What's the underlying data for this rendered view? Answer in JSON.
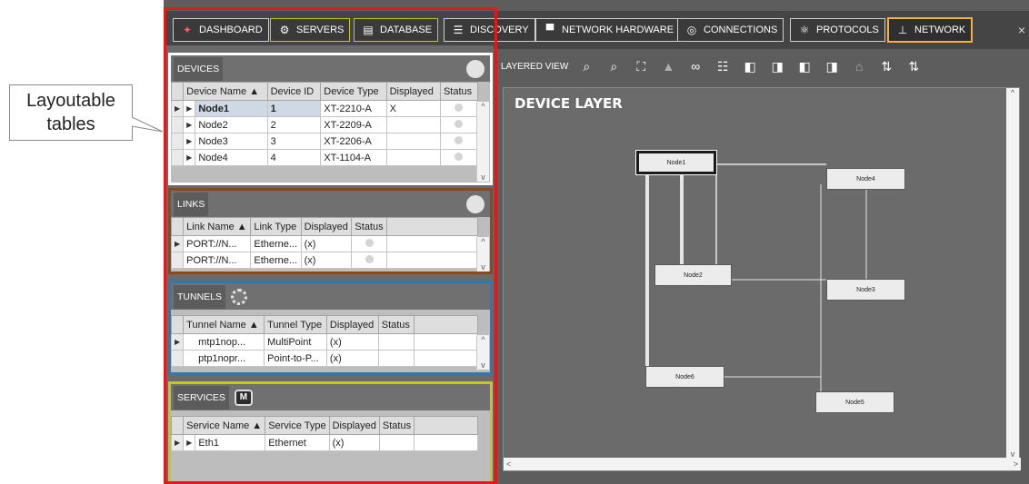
{
  "callout": {
    "text": "Layoutable\ntables"
  },
  "tabs": [
    {
      "label": "DASHBOARD",
      "icon": "dashboard-icon",
      "glyph": "✦"
    },
    {
      "label": "SERVERS",
      "icon": "gear-icon",
      "glyph": "⚙"
    },
    {
      "label": "DATABASE",
      "icon": "database-icon",
      "glyph": "▤"
    },
    {
      "label": "DISCOVERY",
      "icon": "list-icon",
      "glyph": "☰"
    },
    {
      "label": "NETWORK HARDWARE",
      "icon": "hardware-icon",
      "glyph": "▀"
    },
    {
      "label": "CONNECTIONS",
      "icon": "connections-icon",
      "glyph": "◎"
    },
    {
      "label": "PROTOCOLS",
      "icon": "protocols-icon",
      "glyph": "⚛"
    },
    {
      "label": "NETWORK",
      "icon": "network-icon",
      "glyph": "⊥"
    }
  ],
  "close_glyph": "×",
  "devices": {
    "title": "DEVICES",
    "columns": [
      "Device Name ▲",
      "Device ID",
      "Device Type",
      "Displayed",
      "Status"
    ],
    "rows": [
      {
        "name": "Node1",
        "id": "1",
        "type": "XT-2210-A",
        "displayed": "X"
      },
      {
        "name": "Node2",
        "id": "2",
        "type": "XT-2209-A",
        "displayed": ""
      },
      {
        "name": "Node3",
        "id": "3",
        "type": "XT-2206-A",
        "displayed": ""
      },
      {
        "name": "Node4",
        "id": "4",
        "type": "XT-1104-A",
        "displayed": ""
      }
    ]
  },
  "links": {
    "title": "LINKS",
    "columns": [
      "Link Name ▲",
      "Link Type",
      "Displayed",
      "Status"
    ],
    "rows": [
      {
        "name": "PORT://N...",
        "type": "Etherne...",
        "displayed": "(x)"
      },
      {
        "name": "PORT://N...",
        "type": "Etherne...",
        "displayed": "(x)"
      }
    ]
  },
  "tunnels": {
    "title": "TUNNELS",
    "columns": [
      "Tunnel Name ▲",
      "Tunnel Type",
      "Displayed",
      "Status"
    ],
    "rows": [
      {
        "name": "mtp1nop...",
        "type": "MultiPoint",
        "displayed": "(x)"
      },
      {
        "name": "ptp1nopr...",
        "type": "Point-to-P...",
        "displayed": "(x)"
      }
    ]
  },
  "services": {
    "title": "SERVICES",
    "badge": "M",
    "columns": [
      "Service Name ▲",
      "Service Type",
      "Displayed",
      "Status"
    ],
    "rows": [
      {
        "name": "Eth1",
        "type": "Ethernet",
        "displayed": "(x)"
      }
    ]
  },
  "layered_view": {
    "label": "LAYERED VIEW",
    "toolbar_icons": [
      "zoom-in-icon",
      "zoom-out-icon",
      "fit-icon",
      "image-icon",
      "link-icon",
      "arrange-icon",
      "front-icon",
      "back-icon",
      "group-icon",
      "ungroup-icon",
      "tree-icon",
      "up-p-icon",
      "down-n-icon"
    ],
    "title": "DEVICE LAYER",
    "nodes": [
      "Node1",
      "Node4",
      "Node2",
      "Node3",
      "Node6",
      "Node5"
    ]
  },
  "colors": {
    "devices_border": "#ffffff",
    "links_border": "#8a4a1c",
    "tunnels_border": "#2a79b5",
    "services_border": "#c6c61e",
    "frame_red": "#e01a1a",
    "network_tab": "#f5b13a"
  }
}
